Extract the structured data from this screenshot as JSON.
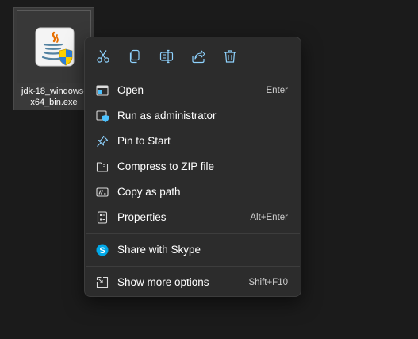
{
  "file": {
    "name_line1": "jdk-18_windows-",
    "name_line2": "x64_bin.exe",
    "icon": "java-installer-icon"
  },
  "toolbar": [
    {
      "icon": "cut-icon"
    },
    {
      "icon": "copy-icon"
    },
    {
      "icon": "rename-icon"
    },
    {
      "icon": "share-icon"
    },
    {
      "icon": "delete-icon"
    }
  ],
  "menu": {
    "open": {
      "label": "Open",
      "shortcut": "Enter",
      "icon": "open-app-icon"
    },
    "run_as_admin": {
      "label": "Run as administrator",
      "icon": "shield-admin-icon"
    },
    "pin_to_start": {
      "label": "Pin to Start",
      "icon": "pin-icon"
    },
    "compress_zip": {
      "label": "Compress to ZIP file",
      "icon": "zip-folder-icon"
    },
    "copy_as_path": {
      "label": "Copy as path",
      "icon": "copy-path-icon"
    },
    "properties": {
      "label": "Properties",
      "shortcut": "Alt+Enter",
      "icon": "properties-icon"
    },
    "share_skype": {
      "label": "Share with Skype",
      "icon": "skype-icon"
    },
    "show_more": {
      "label": "Show more options",
      "shortcut": "Shift+F10",
      "icon": "show-more-icon"
    }
  },
  "colors": {
    "accent": "#4cc2ff",
    "menu_bg": "#2c2c2c",
    "desktop_bg": "#1b1b1b"
  }
}
